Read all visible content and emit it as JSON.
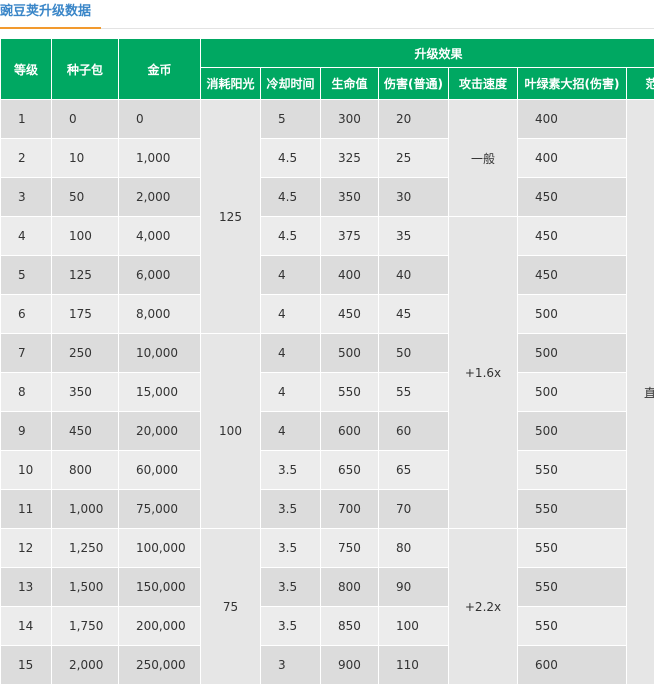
{
  "title": "豌豆荚升级数据",
  "headers": {
    "level": "等级",
    "seed": "种子包",
    "coin": "金币",
    "effects": "升级效果",
    "sun": "消耗阳光",
    "cooldown": "冷却时间",
    "hp": "生命值",
    "damage": "伤害(普通)",
    "speed": "攻击速度",
    "ult": "叶绿素大招(伤害)",
    "range": "范"
  },
  "sun_groups": [
    "125",
    "100",
    "75"
  ],
  "speed_groups": [
    "一般",
    "+1.6x",
    "+2.2x"
  ],
  "range_value": "直",
  "rows": [
    {
      "level": "1",
      "seed": "0",
      "coin": "0",
      "cooldown": "5",
      "hp": "300",
      "damage": "20",
      "ult": "400"
    },
    {
      "level": "2",
      "seed": "10",
      "coin": "1,000",
      "cooldown": "4.5",
      "hp": "325",
      "damage": "25",
      "ult": "400"
    },
    {
      "level": "3",
      "seed": "50",
      "coin": "2,000",
      "cooldown": "4.5",
      "hp": "350",
      "damage": "30",
      "ult": "450"
    },
    {
      "level": "4",
      "seed": "100",
      "coin": "4,000",
      "cooldown": "4.5",
      "hp": "375",
      "damage": "35",
      "ult": "450"
    },
    {
      "level": "5",
      "seed": "125",
      "coin": "6,000",
      "cooldown": "4",
      "hp": "400",
      "damage": "40",
      "ult": "450"
    },
    {
      "level": "6",
      "seed": "175",
      "coin": "8,000",
      "cooldown": "4",
      "hp": "450",
      "damage": "45",
      "ult": "500"
    },
    {
      "level": "7",
      "seed": "250",
      "coin": "10,000",
      "cooldown": "4",
      "hp": "500",
      "damage": "50",
      "ult": "500"
    },
    {
      "level": "8",
      "seed": "350",
      "coin": "15,000",
      "cooldown": "4",
      "hp": "550",
      "damage": "55",
      "ult": "500"
    },
    {
      "level": "9",
      "seed": "450",
      "coin": "20,000",
      "cooldown": "4",
      "hp": "600",
      "damage": "60",
      "ult": "500"
    },
    {
      "level": "10",
      "seed": "800",
      "coin": "60,000",
      "cooldown": "3.5",
      "hp": "650",
      "damage": "65",
      "ult": "550"
    },
    {
      "level": "11",
      "seed": "1,000",
      "coin": "75,000",
      "cooldown": "3.5",
      "hp": "700",
      "damage": "70",
      "ult": "550"
    },
    {
      "level": "12",
      "seed": "1,250",
      "coin": "100,000",
      "cooldown": "3.5",
      "hp": "750",
      "damage": "80",
      "ult": "550"
    },
    {
      "level": "13",
      "seed": "1,500",
      "coin": "150,000",
      "cooldown": "3.5",
      "hp": "800",
      "damage": "90",
      "ult": "550"
    },
    {
      "level": "14",
      "seed": "1,750",
      "coin": "200,000",
      "cooldown": "3.5",
      "hp": "850",
      "damage": "100",
      "ult": "550"
    },
    {
      "level": "15",
      "seed": "2,000",
      "coin": "250,000",
      "cooldown": "3",
      "hp": "900",
      "damage": "110",
      "ult": "600"
    }
  ]
}
